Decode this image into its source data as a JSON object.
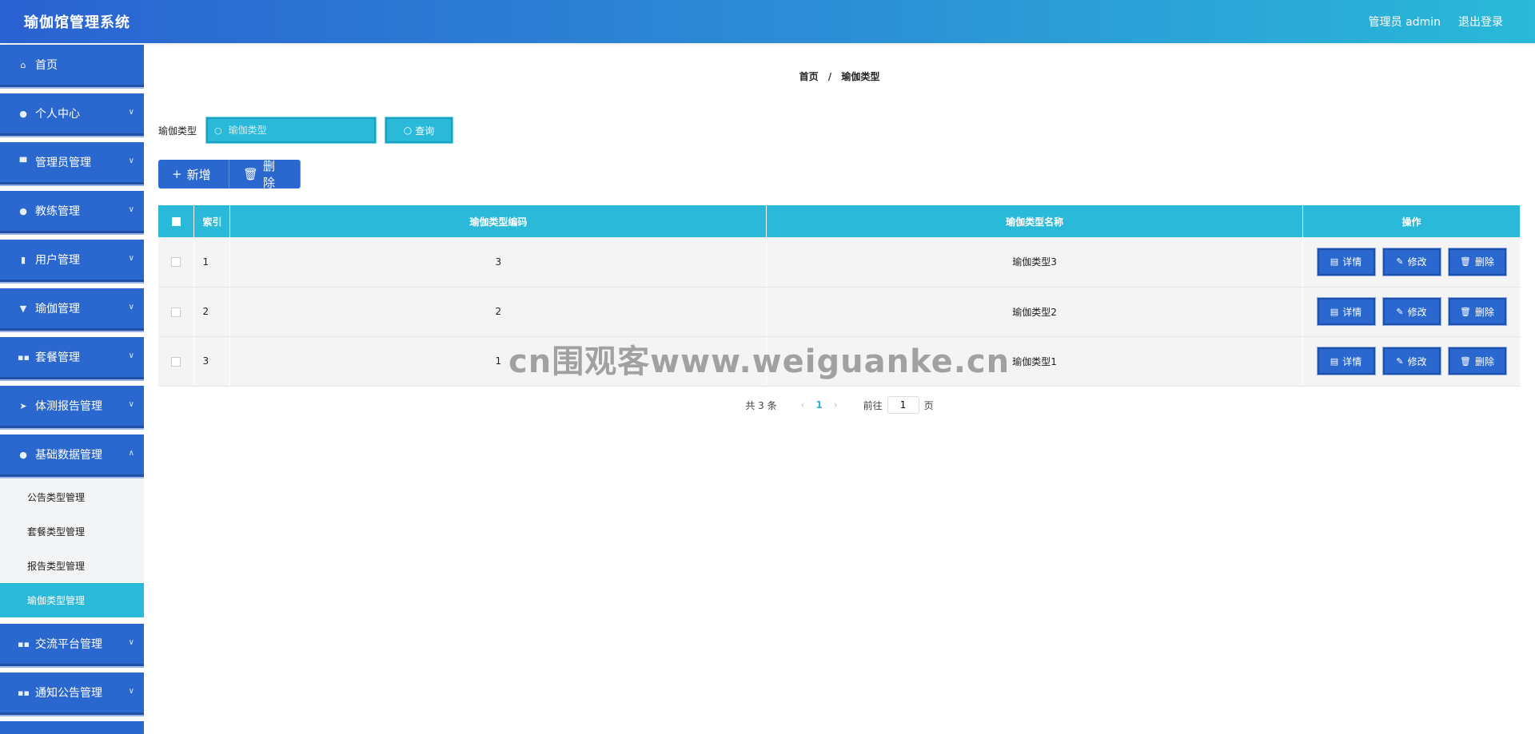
{
  "header": {
    "title": "瑜伽馆管理系统",
    "user_label": "管理员 admin",
    "logout_label": "退出登录"
  },
  "sidebar": {
    "items": [
      {
        "label": "首页",
        "icon": "home-icon"
      },
      {
        "label": "个人中心",
        "icon": "user-icon"
      },
      {
        "label": "管理员管理",
        "icon": "monitor-icon"
      },
      {
        "label": "教练管理",
        "icon": "user-icon"
      },
      {
        "label": "用户管理",
        "icon": "clipboard-icon"
      },
      {
        "label": "瑜伽管理",
        "icon": "flag-icon"
      },
      {
        "label": "套餐管理",
        "icon": "grid-icon"
      },
      {
        "label": "体测报告管理",
        "icon": "send-icon"
      },
      {
        "label": "基础数据管理",
        "icon": "location-icon"
      },
      {
        "label": "交流平台管理",
        "icon": "grid-icon"
      },
      {
        "label": "通知公告管理",
        "icon": "grid-icon"
      }
    ],
    "submenu": [
      {
        "label": "公告类型管理"
      },
      {
        "label": "套餐类型管理"
      },
      {
        "label": "报告类型管理"
      },
      {
        "label": "瑜伽类型管理"
      }
    ]
  },
  "breadcrumb": {
    "home": "首页",
    "separator": "/",
    "current": "瑜伽类型"
  },
  "search": {
    "label": "瑜伽类型",
    "placeholder": "瑜伽类型",
    "button_label": "查询"
  },
  "actions": {
    "add_label": "新增",
    "delete_label": "删除"
  },
  "table": {
    "columns": [
      "索引",
      "瑜伽类型编码",
      "瑜伽类型名称",
      "操作"
    ],
    "rows": [
      {
        "index": "1",
        "code": "3",
        "name": "瑜伽类型3"
      },
      {
        "index": "2",
        "code": "2",
        "name": "瑜伽类型2"
      },
      {
        "index": "3",
        "code": "1",
        "name": "瑜伽类型1"
      }
    ],
    "op_labels": {
      "detail": "详情",
      "edit": "修改",
      "delete": "删除"
    }
  },
  "pagination": {
    "total_text": "共 3 条",
    "current_page": "1",
    "goto_label": "前往",
    "goto_value": "1",
    "page_suffix": "页"
  },
  "watermark": "cn围观客www.weiguanke.cn"
}
